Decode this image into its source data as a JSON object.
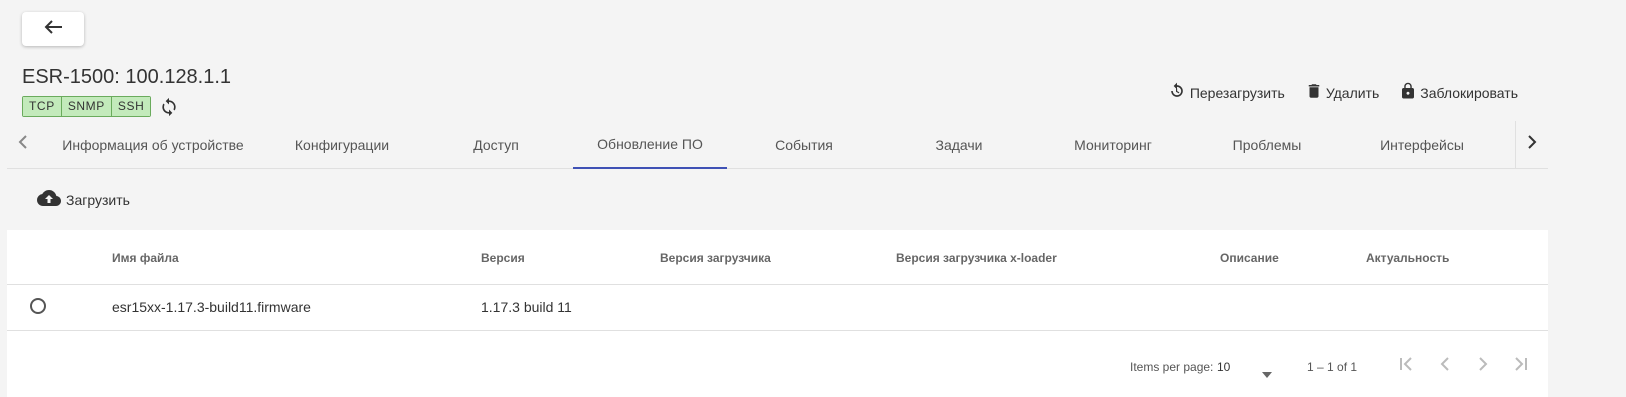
{
  "header": {
    "back_icon": "arrow-left-icon",
    "device_title": "ESR-1500: 100.128.1.1",
    "protocols": [
      "TCP",
      "SNMP",
      "SSH"
    ],
    "protocol_badge_color": "#c3eabb",
    "refresh_icon": "sync-icon"
  },
  "actions": [
    {
      "icon": "restart-icon",
      "label": "Перезагрузить"
    },
    {
      "icon": "trash-icon",
      "label": "Удалить"
    },
    {
      "icon": "lock-icon",
      "label": "Заблокировать"
    }
  ],
  "tabs": [
    {
      "label": "Информация об устройстве"
    },
    {
      "label": "Конфигурации"
    },
    {
      "label": "Доступ"
    },
    {
      "label": "Обновление ПО",
      "active": true
    },
    {
      "label": "События"
    },
    {
      "label": "Задачи"
    },
    {
      "label": "Мониторинг"
    },
    {
      "label": "Проблемы"
    },
    {
      "label": "Интерфейсы"
    }
  ],
  "accent_color": "#3f51b5",
  "toolbar": {
    "upload_label": "Загрузить",
    "upload_icon": "cloud-upload-icon"
  },
  "table": {
    "columns": [
      "Имя файла",
      "Версия",
      "Версия загрузчика",
      "Версия загрузчика  x-loader",
      "Описание",
      "Актуальность"
    ],
    "rows": [
      {
        "selected": false,
        "cells": [
          "esr15xx-1.17.3-build11.firmware",
          "1.17.3 build 11",
          "",
          "",
          "",
          ""
        ]
      }
    ]
  },
  "paginator": {
    "items_per_page_label": "Items per page:",
    "page_size": "10",
    "range_label": "1 – 1 of 1"
  }
}
